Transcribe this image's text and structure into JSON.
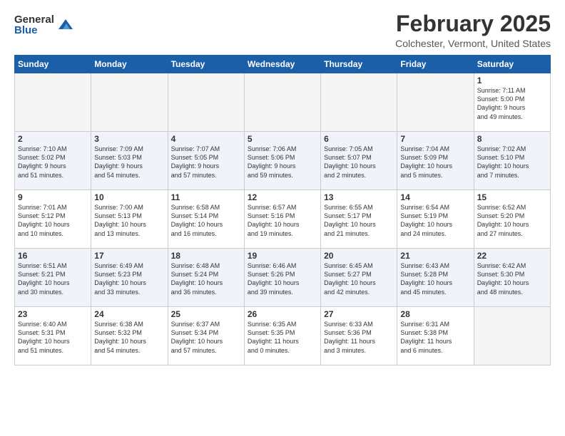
{
  "header": {
    "logo_general": "General",
    "logo_blue": "Blue",
    "month_year": "February 2025",
    "location": "Colchester, Vermont, United States"
  },
  "weekdays": [
    "Sunday",
    "Monday",
    "Tuesday",
    "Wednesday",
    "Thursday",
    "Friday",
    "Saturday"
  ],
  "weeks": [
    [
      {
        "day": "",
        "info": ""
      },
      {
        "day": "",
        "info": ""
      },
      {
        "day": "",
        "info": ""
      },
      {
        "day": "",
        "info": ""
      },
      {
        "day": "",
        "info": ""
      },
      {
        "day": "",
        "info": ""
      },
      {
        "day": "1",
        "info": "Sunrise: 7:11 AM\nSunset: 5:00 PM\nDaylight: 9 hours\nand 49 minutes."
      }
    ],
    [
      {
        "day": "2",
        "info": "Sunrise: 7:10 AM\nSunset: 5:02 PM\nDaylight: 9 hours\nand 51 minutes."
      },
      {
        "day": "3",
        "info": "Sunrise: 7:09 AM\nSunset: 5:03 PM\nDaylight: 9 hours\nand 54 minutes."
      },
      {
        "day": "4",
        "info": "Sunrise: 7:07 AM\nSunset: 5:05 PM\nDaylight: 9 hours\nand 57 minutes."
      },
      {
        "day": "5",
        "info": "Sunrise: 7:06 AM\nSunset: 5:06 PM\nDaylight: 9 hours\nand 59 minutes."
      },
      {
        "day": "6",
        "info": "Sunrise: 7:05 AM\nSunset: 5:07 PM\nDaylight: 10 hours\nand 2 minutes."
      },
      {
        "day": "7",
        "info": "Sunrise: 7:04 AM\nSunset: 5:09 PM\nDaylight: 10 hours\nand 5 minutes."
      },
      {
        "day": "8",
        "info": "Sunrise: 7:02 AM\nSunset: 5:10 PM\nDaylight: 10 hours\nand 7 minutes."
      }
    ],
    [
      {
        "day": "9",
        "info": "Sunrise: 7:01 AM\nSunset: 5:12 PM\nDaylight: 10 hours\nand 10 minutes."
      },
      {
        "day": "10",
        "info": "Sunrise: 7:00 AM\nSunset: 5:13 PM\nDaylight: 10 hours\nand 13 minutes."
      },
      {
        "day": "11",
        "info": "Sunrise: 6:58 AM\nSunset: 5:14 PM\nDaylight: 10 hours\nand 16 minutes."
      },
      {
        "day": "12",
        "info": "Sunrise: 6:57 AM\nSunset: 5:16 PM\nDaylight: 10 hours\nand 19 minutes."
      },
      {
        "day": "13",
        "info": "Sunrise: 6:55 AM\nSunset: 5:17 PM\nDaylight: 10 hours\nand 21 minutes."
      },
      {
        "day": "14",
        "info": "Sunrise: 6:54 AM\nSunset: 5:19 PM\nDaylight: 10 hours\nand 24 minutes."
      },
      {
        "day": "15",
        "info": "Sunrise: 6:52 AM\nSunset: 5:20 PM\nDaylight: 10 hours\nand 27 minutes."
      }
    ],
    [
      {
        "day": "16",
        "info": "Sunrise: 6:51 AM\nSunset: 5:21 PM\nDaylight: 10 hours\nand 30 minutes."
      },
      {
        "day": "17",
        "info": "Sunrise: 6:49 AM\nSunset: 5:23 PM\nDaylight: 10 hours\nand 33 minutes."
      },
      {
        "day": "18",
        "info": "Sunrise: 6:48 AM\nSunset: 5:24 PM\nDaylight: 10 hours\nand 36 minutes."
      },
      {
        "day": "19",
        "info": "Sunrise: 6:46 AM\nSunset: 5:26 PM\nDaylight: 10 hours\nand 39 minutes."
      },
      {
        "day": "20",
        "info": "Sunrise: 6:45 AM\nSunset: 5:27 PM\nDaylight: 10 hours\nand 42 minutes."
      },
      {
        "day": "21",
        "info": "Sunrise: 6:43 AM\nSunset: 5:28 PM\nDaylight: 10 hours\nand 45 minutes."
      },
      {
        "day": "22",
        "info": "Sunrise: 6:42 AM\nSunset: 5:30 PM\nDaylight: 10 hours\nand 48 minutes."
      }
    ],
    [
      {
        "day": "23",
        "info": "Sunrise: 6:40 AM\nSunset: 5:31 PM\nDaylight: 10 hours\nand 51 minutes."
      },
      {
        "day": "24",
        "info": "Sunrise: 6:38 AM\nSunset: 5:32 PM\nDaylight: 10 hours\nand 54 minutes."
      },
      {
        "day": "25",
        "info": "Sunrise: 6:37 AM\nSunset: 5:34 PM\nDaylight: 10 hours\nand 57 minutes."
      },
      {
        "day": "26",
        "info": "Sunrise: 6:35 AM\nSunset: 5:35 PM\nDaylight: 11 hours\nand 0 minutes."
      },
      {
        "day": "27",
        "info": "Sunrise: 6:33 AM\nSunset: 5:36 PM\nDaylight: 11 hours\nand 3 minutes."
      },
      {
        "day": "28",
        "info": "Sunrise: 6:31 AM\nSunset: 5:38 PM\nDaylight: 11 hours\nand 6 minutes."
      },
      {
        "day": "",
        "info": ""
      }
    ]
  ]
}
